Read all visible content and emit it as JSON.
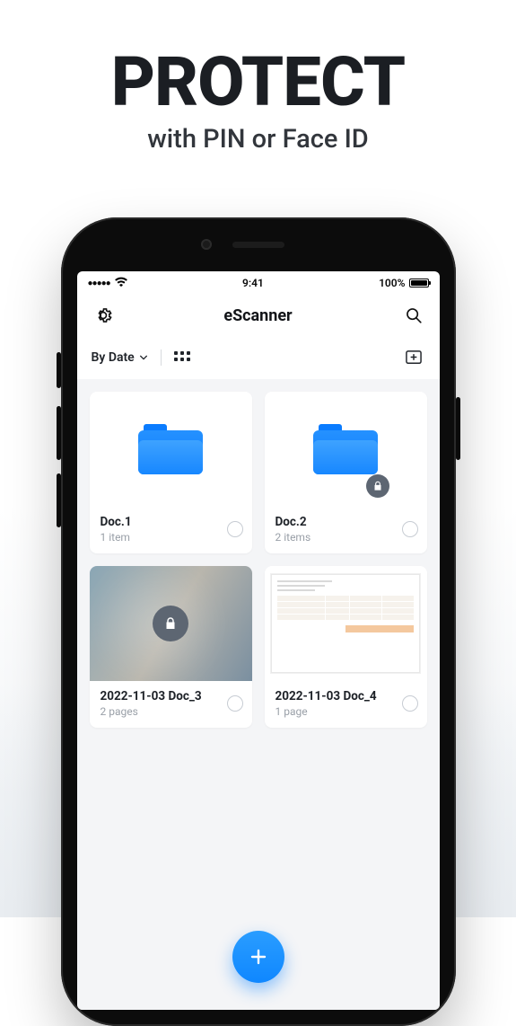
{
  "promo": {
    "title": "PROTECT",
    "subtitle": "with PIN or Face ID"
  },
  "statusbar": {
    "time": "9:41",
    "battery_pct": "100%"
  },
  "nav": {
    "title": "eScanner"
  },
  "toolbar": {
    "sort_label": "By Date"
  },
  "items": [
    {
      "title": "Doc.1",
      "subtitle": "1 item",
      "type": "folder",
      "locked": false
    },
    {
      "title": "Doc.2",
      "subtitle": "2 items",
      "type": "folder",
      "locked": true
    },
    {
      "title": "2022-11-03 Doc_3",
      "subtitle": "2 pages",
      "type": "doc",
      "locked": true
    },
    {
      "title": "2022-11-03 Doc_4",
      "subtitle": "1 page",
      "type": "doc",
      "locked": false
    }
  ]
}
